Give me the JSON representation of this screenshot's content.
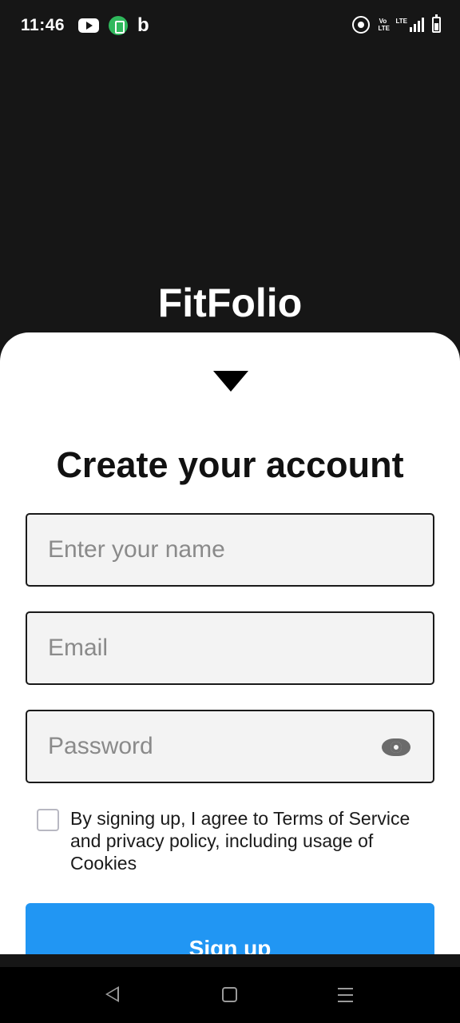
{
  "status_bar": {
    "time": "11:46",
    "left_icons": [
      "youtube-icon",
      "green-app-icon",
      "bing-icon"
    ],
    "bing_glyph": "b",
    "right_icons": [
      "hotspot-icon",
      "volte-icon",
      "signal-icon",
      "battery-icon"
    ],
    "volte_label": "Vo LTE",
    "signal_label": "LTE"
  },
  "app": {
    "title": "FitFolio"
  },
  "signup_sheet": {
    "heading": "Create your account",
    "collapse_icon": "triangle-down-icon",
    "name_field": {
      "placeholder": "Enter your name",
      "value": ""
    },
    "email_field": {
      "placeholder": "Email",
      "value": ""
    },
    "password_field": {
      "placeholder": "Password",
      "value": "",
      "visibility_icon": "eye-icon"
    },
    "terms": {
      "checked": false,
      "text": "By signing up, I agree to Terms of Service and privacy policy, including usage of Cookies"
    },
    "signup_button_label": "Sign up",
    "accent_color": "#2196f3"
  },
  "nav_bar": {
    "buttons": [
      "back-icon",
      "home-icon",
      "menu-icon"
    ]
  }
}
